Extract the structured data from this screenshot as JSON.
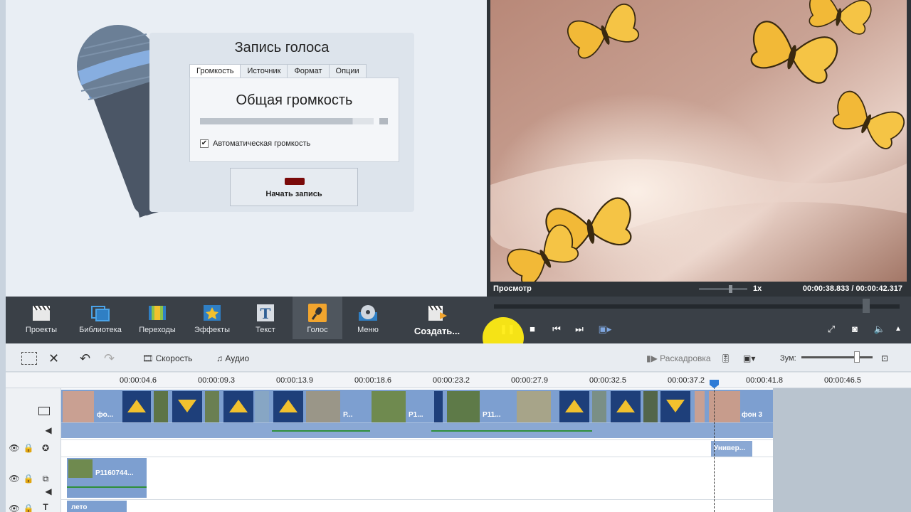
{
  "voice": {
    "title": "Запись голоса",
    "tabs": [
      "Громкость",
      "Источник",
      "Формат",
      "Опции"
    ],
    "gain_title": "Общая громкость",
    "gain_level": 0.88,
    "auto_gain_label": "Автоматическая громкость",
    "auto_gain_checked": true,
    "record_label": "Начать запись"
  },
  "preview": {
    "label": "Просмотр",
    "speed": "1x",
    "time_current": "00:00:38.833",
    "time_separator": "/",
    "time_total": "00:00:42.317"
  },
  "toolbar": {
    "items": [
      "Проекты",
      "Библиотека",
      "Переходы",
      "Эффекты",
      "Текст",
      "Голос",
      "Меню"
    ],
    "create_label": "Создать..."
  },
  "timeline_toolbar": {
    "speed_label": "Скорость",
    "audio_label": "Аудио",
    "storyboard_label": "Раскадровка",
    "zoom_label": "Зум:"
  },
  "ruler": {
    "labels": [
      "00:00:04.6",
      "00:00:09.3",
      "00:00:13.9",
      "00:00:18.6",
      "00:00:23.2",
      "00:00:27.9",
      "00:00:32.5",
      "00:00:37.2",
      "00:00:41.8",
      "00:00:46.5"
    ]
  },
  "clips": {
    "first_label": "фо...",
    "p1": "Р...",
    "p2": "P1...",
    "p3": "P11...",
    "last_label": "фон 3",
    "text_clip": "Универ...",
    "overlay_clip": "P1160744...",
    "title_clip": "лето"
  },
  "colors": {
    "toolbar_bg": "#3a4047",
    "clip_band": "#7d9fd0",
    "accent_playhead": "#2e7bd6",
    "record_red": "#7a0a0a"
  }
}
